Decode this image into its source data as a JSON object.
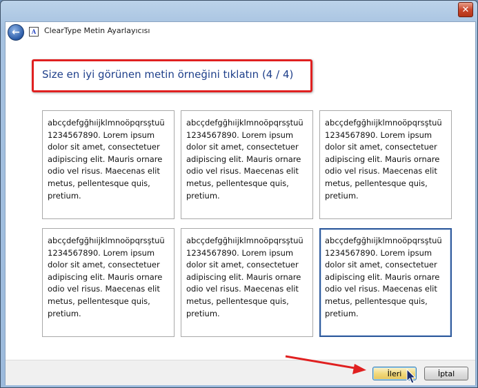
{
  "window": {
    "title": "ClearType Metin Ayarlayıcısı",
    "close_label": "✕",
    "back_label": "←",
    "app_icon_glyph": "A"
  },
  "instruction": "Size en iyi görünen metin örneğini tıklatın (4 / 4)",
  "samples": [
    {
      "lines": [
        "abcçdefgğhıijklmnoöpqrsştuü",
        "1234567890. Lorem ipsum",
        "dolor sit amet, consectetuer",
        "adipiscing elit. Mauris ornare",
        "odio vel risus. Maecenas elit",
        "metus, pellentesque quis,",
        "pretium."
      ],
      "selected": false
    },
    {
      "lines": [
        "abcçdefgğhıijklmnoöpqrsştuü",
        "1234567890. Lorem ipsum",
        "dolor sit amet, consectetuer",
        "adipiscing elit. Mauris ornare",
        "odio vel risus. Maecenas elit",
        "metus, pellentesque quis,",
        "pretium."
      ],
      "selected": false
    },
    {
      "lines": [
        "abcçdefgğhıijklmnoöpqrsştuü",
        "1234567890. Lorem ipsum",
        "dolor sit amet, consectetuer",
        "adipiscing elit. Mauris ornare",
        "odio vel risus. Maecenas elit",
        "metus, pellentesque quis,",
        "pretium."
      ],
      "selected": false
    },
    {
      "lines": [
        "abcçdefgğhıijklmnoöpqrsştuü",
        "1234567890. Lorem ipsum",
        "dolor sit amet, consectetuer",
        "adipiscing elit. Mauris ornare",
        "odio vel risus. Maecenas elit",
        "metus, pellentesque quis,",
        "pretium."
      ],
      "selected": false
    },
    {
      "lines": [
        "abcçdefgğhıijklmnoöpqrsştuü",
        "1234567890. Lorem ipsum",
        "dolor sit amet, consectetuer",
        "adipiscing elit. Mauris ornare",
        "odio vel risus. Maecenas elit",
        "metus, pellentesque quis,",
        "pretium."
      ],
      "selected": false
    },
    {
      "lines": [
        "abcçdefgğhıijklmnoöpqrsştuü",
        "1234567890. Lorem ipsum",
        "dolor sit amet, consectetuer",
        "adipiscing elit. Mauris ornare",
        "odio vel risus. Maecenas elit",
        "metus, pellentesque quis,",
        "pretium."
      ],
      "selected": true
    }
  ],
  "footer": {
    "next_label": "İleri",
    "cancel_label": "İptal"
  },
  "colors": {
    "annotation_red": "#e02020",
    "instruction_blue": "#1e3f8a",
    "selected_border": "#2f5a9c"
  }
}
